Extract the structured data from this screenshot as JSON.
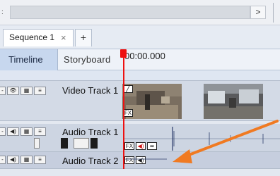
{
  "scroll": {
    "right_arrow": ">",
    "left_marker": ":"
  },
  "tabs": {
    "sequence_label": "Sequence 1",
    "close_glyph": "×",
    "add_glyph": "+"
  },
  "header": {
    "timeline_label": "Timeline",
    "storyboard_label": "Storyboard",
    "timecode": "00:00.000"
  },
  "tracks": [
    {
      "name": "Video Track 1",
      "kind": "video",
      "controls": [
        "-",
        "👁",
        "▦",
        "≡"
      ]
    },
    {
      "name": "Audio Track 1",
      "kind": "audio",
      "controls": [
        "-",
        "◀)",
        "▦",
        "≡"
      ]
    },
    {
      "name": "Audio Track 2",
      "kind": "audio",
      "controls": [
        "-",
        "◀)",
        "▦",
        "≡"
      ]
    }
  ],
  "clip_badges": {
    "fx": "FX",
    "loop": "∞"
  },
  "colors": {
    "playhead": "#e11111",
    "arrow": "#f07a22",
    "timeline_tab": "#c7d7ee"
  }
}
